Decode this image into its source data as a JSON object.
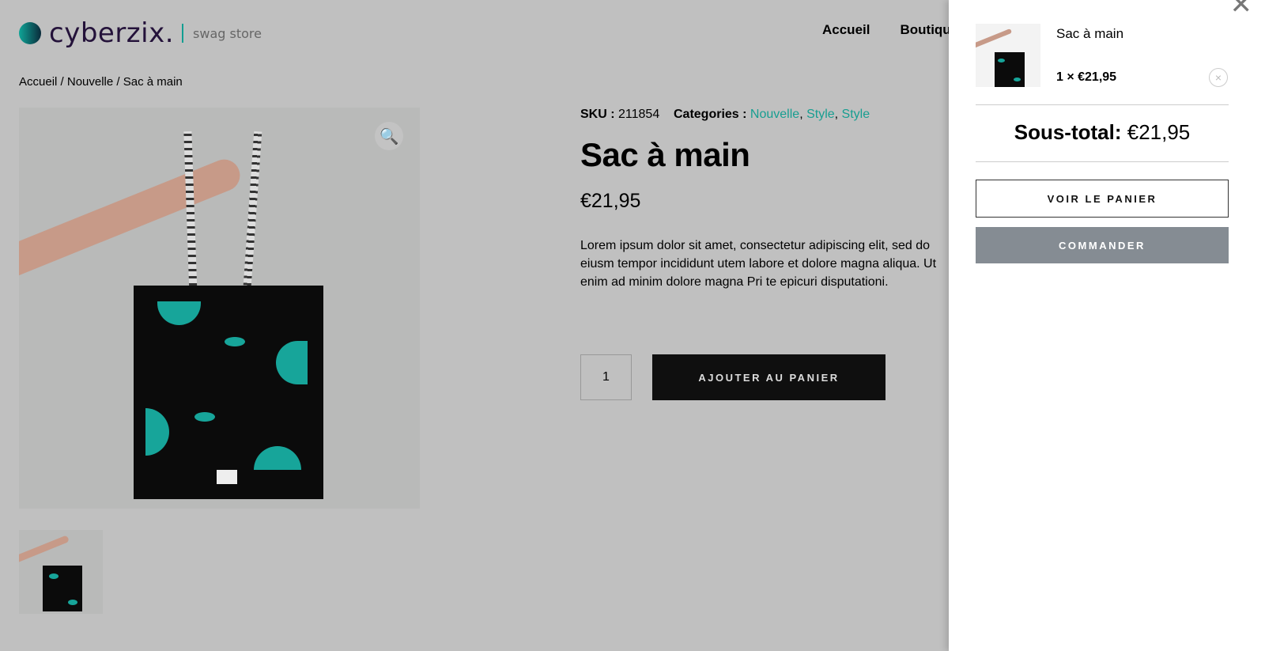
{
  "header": {
    "logo_name": "cyberzix.",
    "logo_tagline": "swag store",
    "nav": [
      "Accueil",
      "Boutique"
    ]
  },
  "breadcrumb": "Accueil / Nouvelle / Sac à main",
  "product": {
    "sku_label": "SKU :",
    "sku": "211854",
    "categories_label": "Categories :",
    "categories": [
      "Nouvelle",
      "Style",
      "Style"
    ],
    "title": "Sac à main",
    "price": "€21,95",
    "description": "Lorem ipsum dolor sit amet, consectetur adipiscing elit, sed do eiusm tempor incididunt utem labore et dolore magna aliqua. Ut enim ad minim dolore magna Pri te epicuri disputationi.",
    "quantity": "1",
    "add_to_cart": "AJOUTER AU PANIER",
    "zoom_icon": "magnifier-icon"
  },
  "cart": {
    "close_icon": "close-icon",
    "item_name": "Sac à main",
    "item_qty_price": "1 × €21,95",
    "remove_icon": "×",
    "subtotal_label": "Sous-total:",
    "subtotal": "€21,95",
    "view_cart": "VOIR LE PANIER",
    "checkout": "COMMANDER"
  },
  "colors": {
    "accent": "#179e91",
    "checkout_bg": "#858c93",
    "overlay": "#c0c0c0"
  }
}
